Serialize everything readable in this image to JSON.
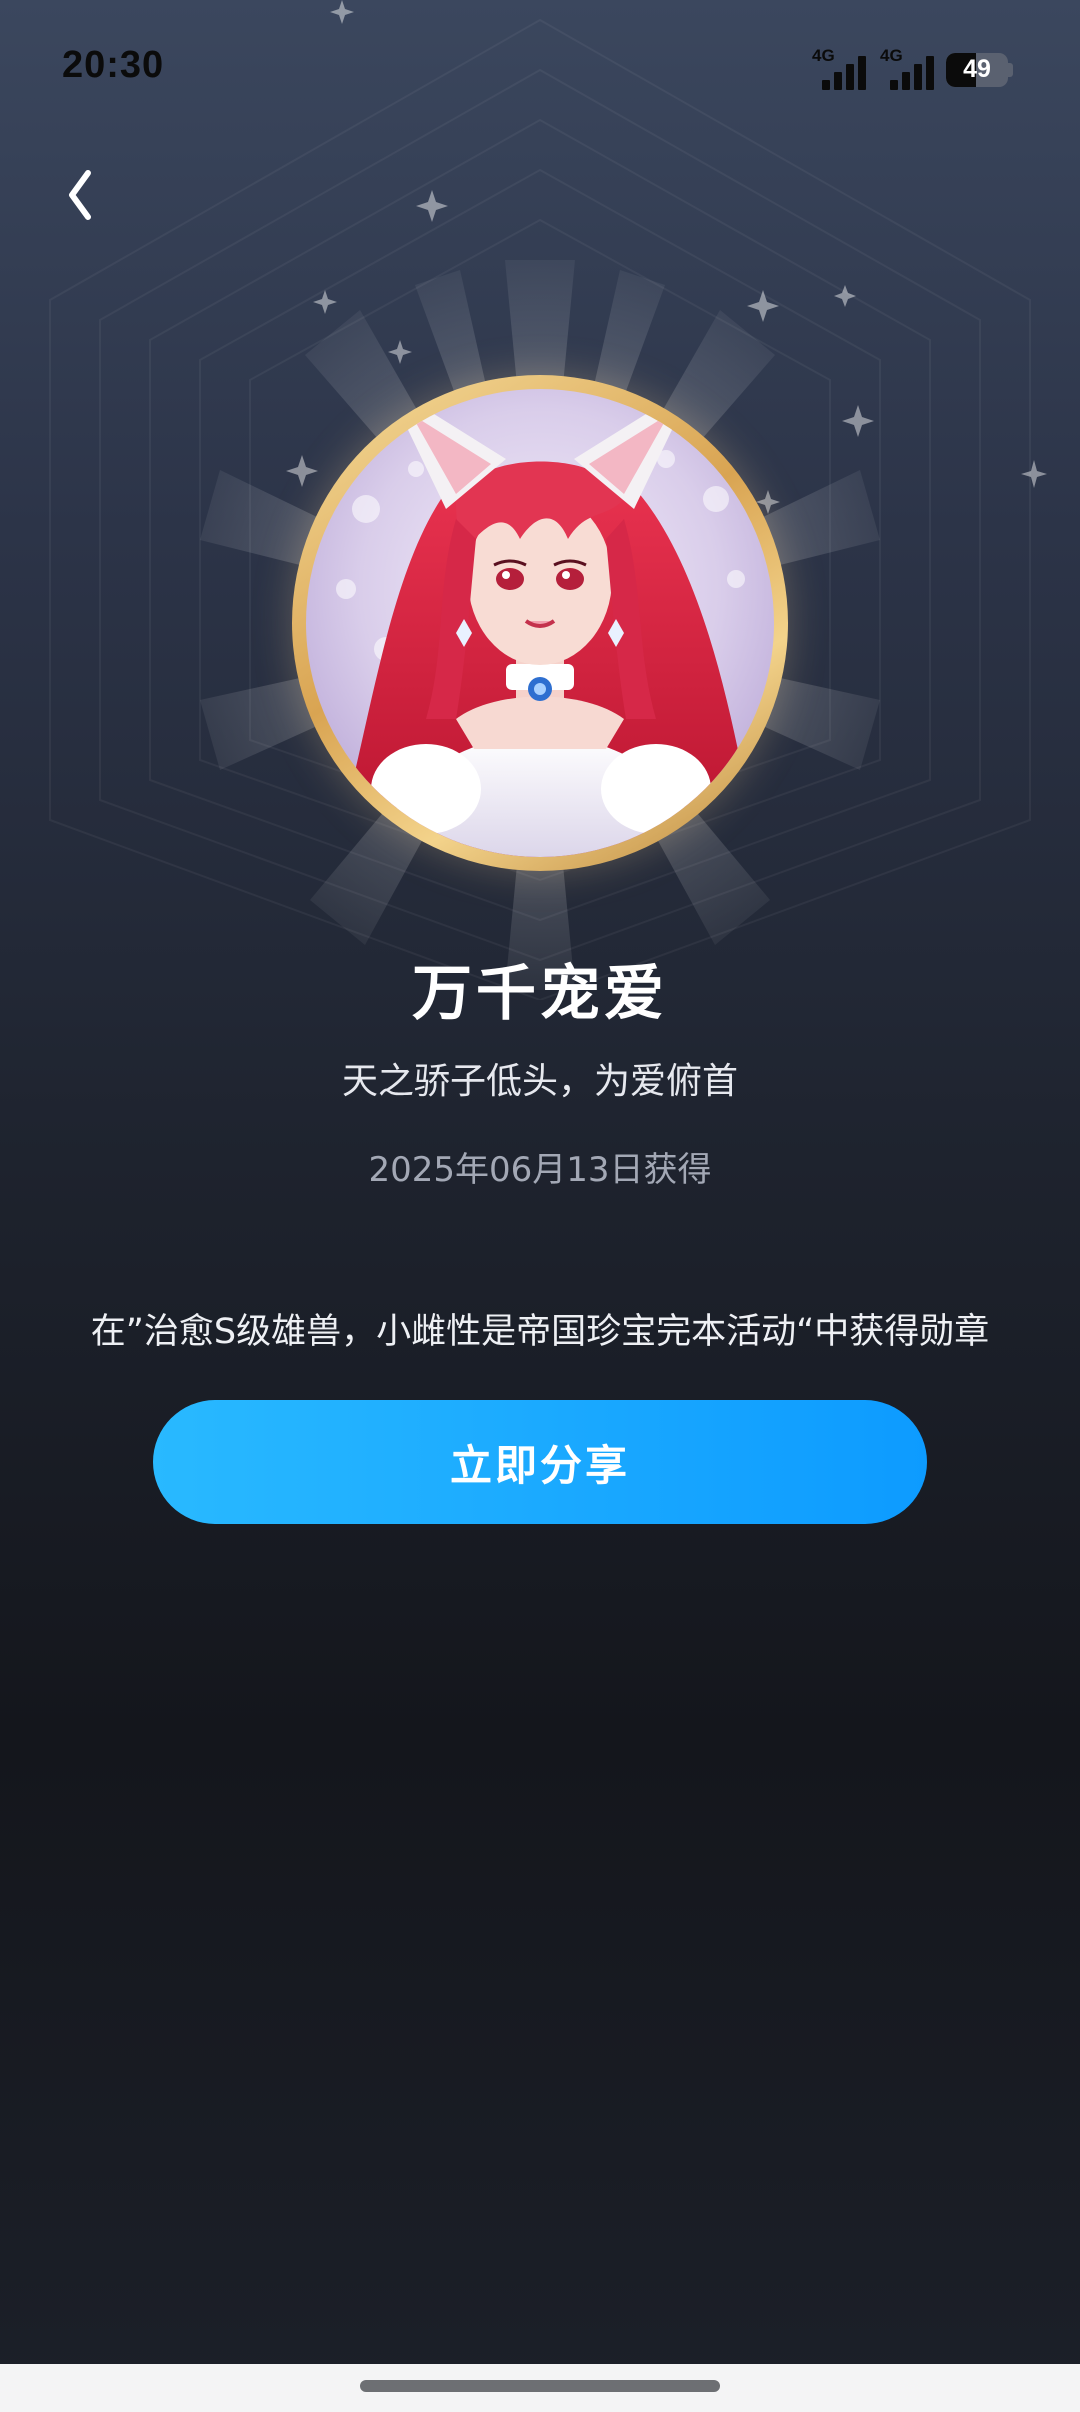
{
  "status_bar": {
    "time": "20:30",
    "signals": [
      {
        "network": "4G",
        "strength": 4
      },
      {
        "network": "4G",
        "strength": 4
      }
    ],
    "battery": {
      "level": "49",
      "fraction": 0.49
    }
  },
  "navigation": {
    "back_icon": "chevron-left-icon"
  },
  "badge": {
    "icon": "fox-eared-anime-girl-portrait",
    "frame_color": "#e0b15e"
  },
  "title": "万千宠爱",
  "subtitle": "天之骄子低头，为爱俯首",
  "obtained_date": "2025年06月13日获得",
  "description": "在”治愈S级雄兽，小雌性是帝国珍宝完本活动“中获得勋章",
  "share_button": {
    "label": "立即分享",
    "color": "#1aa9ff"
  }
}
